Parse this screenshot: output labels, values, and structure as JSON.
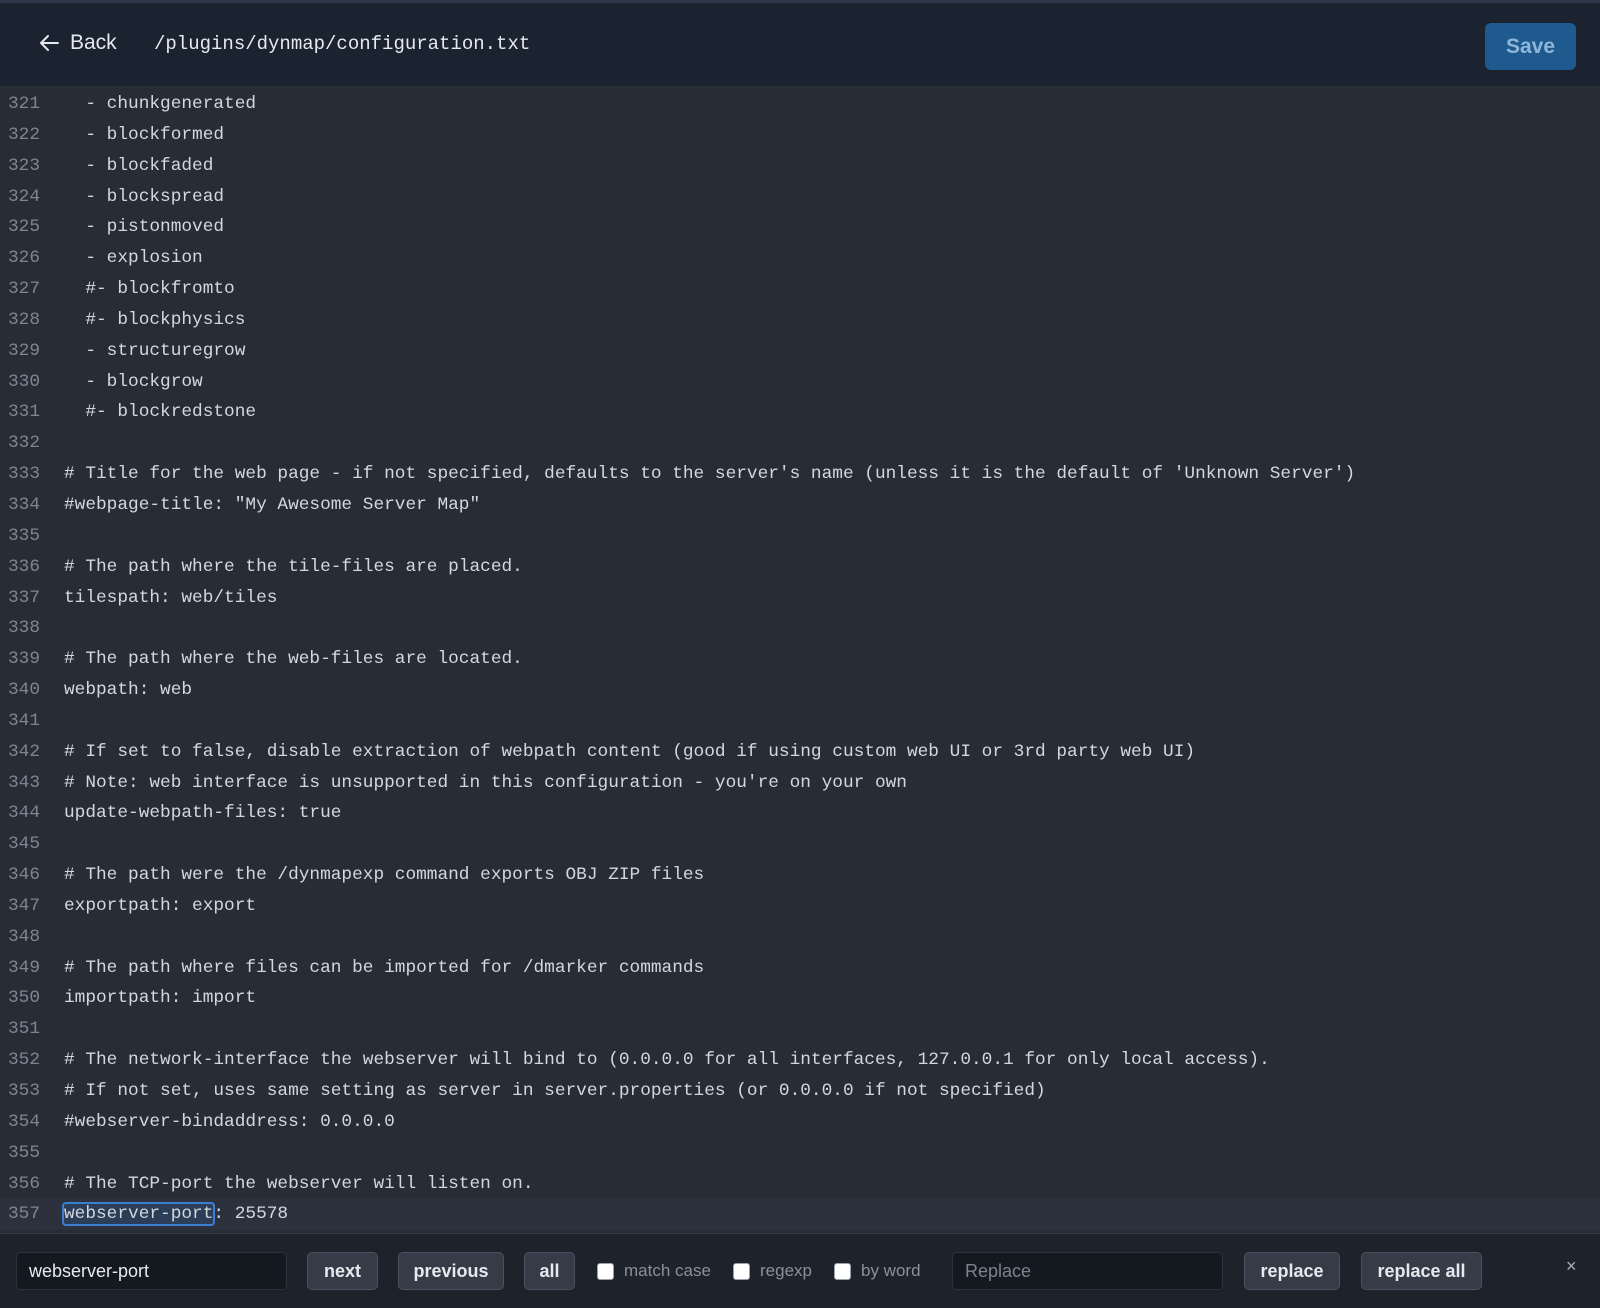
{
  "header": {
    "back_label": "Back",
    "file_path": "/plugins/dynmap/configuration.txt",
    "save_label": "Save"
  },
  "editor": {
    "lines": [
      {
        "num": "321",
        "text": "  - chunkgenerated"
      },
      {
        "num": "322",
        "text": "  - blockformed"
      },
      {
        "num": "323",
        "text": "  - blockfaded"
      },
      {
        "num": "324",
        "text": "  - blockspread"
      },
      {
        "num": "325",
        "text": "  - pistonmoved"
      },
      {
        "num": "326",
        "text": "  - explosion"
      },
      {
        "num": "327",
        "text": "  #- blockfromto"
      },
      {
        "num": "328",
        "text": "  #- blockphysics"
      },
      {
        "num": "329",
        "text": "  - structuregrow"
      },
      {
        "num": "330",
        "text": "  - blockgrow"
      },
      {
        "num": "331",
        "text": "  #- blockredstone"
      },
      {
        "num": "332",
        "text": ""
      },
      {
        "num": "333",
        "text": "# Title for the web page - if not specified, defaults to the server's name (unless it is the default of 'Unknown Server')"
      },
      {
        "num": "334",
        "text": "#webpage-title: \"My Awesome Server Map\""
      },
      {
        "num": "335",
        "text": ""
      },
      {
        "num": "336",
        "text": "# The path where the tile-files are placed."
      },
      {
        "num": "337",
        "text": "tilespath: web/tiles"
      },
      {
        "num": "338",
        "text": ""
      },
      {
        "num": "339",
        "text": "# The path where the web-files are located."
      },
      {
        "num": "340",
        "text": "webpath: web"
      },
      {
        "num": "341",
        "text": ""
      },
      {
        "num": "342",
        "text": "# If set to false, disable extraction of webpath content (good if using custom web UI or 3rd party web UI)"
      },
      {
        "num": "343",
        "text": "# Note: web interface is unsupported in this configuration - you're on your own"
      },
      {
        "num": "344",
        "text": "update-webpath-files: true"
      },
      {
        "num": "345",
        "text": ""
      },
      {
        "num": "346",
        "text": "# The path were the /dynmapexp command exports OBJ ZIP files"
      },
      {
        "num": "347",
        "text": "exportpath: export"
      },
      {
        "num": "348",
        "text": ""
      },
      {
        "num": "349",
        "text": "# The path where files can be imported for /dmarker commands"
      },
      {
        "num": "350",
        "text": "importpath: import"
      },
      {
        "num": "351",
        "text": ""
      },
      {
        "num": "352",
        "text": "# The network-interface the webserver will bind to (0.0.0.0 for all interfaces, 127.0.0.1 for only local access)."
      },
      {
        "num": "353",
        "text": "# If not set, uses same setting as server in server.properties (or 0.0.0.0 if not specified)"
      },
      {
        "num": "354",
        "text": "#webserver-bindaddress: 0.0.0.0"
      },
      {
        "num": "355",
        "text": ""
      },
      {
        "num": "356",
        "text": "# The TCP-port the webserver will listen on."
      }
    ],
    "active_line": {
      "num": "357",
      "match": "webserver-port",
      "rest": ": 25578"
    }
  },
  "findbar": {
    "search_value": "webserver-port",
    "next_label": "next",
    "previous_label": "previous",
    "all_label": "all",
    "match_case_label": "match case",
    "regexp_label": "regexp",
    "by_word_label": "by word",
    "replace_placeholder": "Replace",
    "replace_label": "replace",
    "replace_all_label": "replace all",
    "close_glyph": "×"
  }
}
